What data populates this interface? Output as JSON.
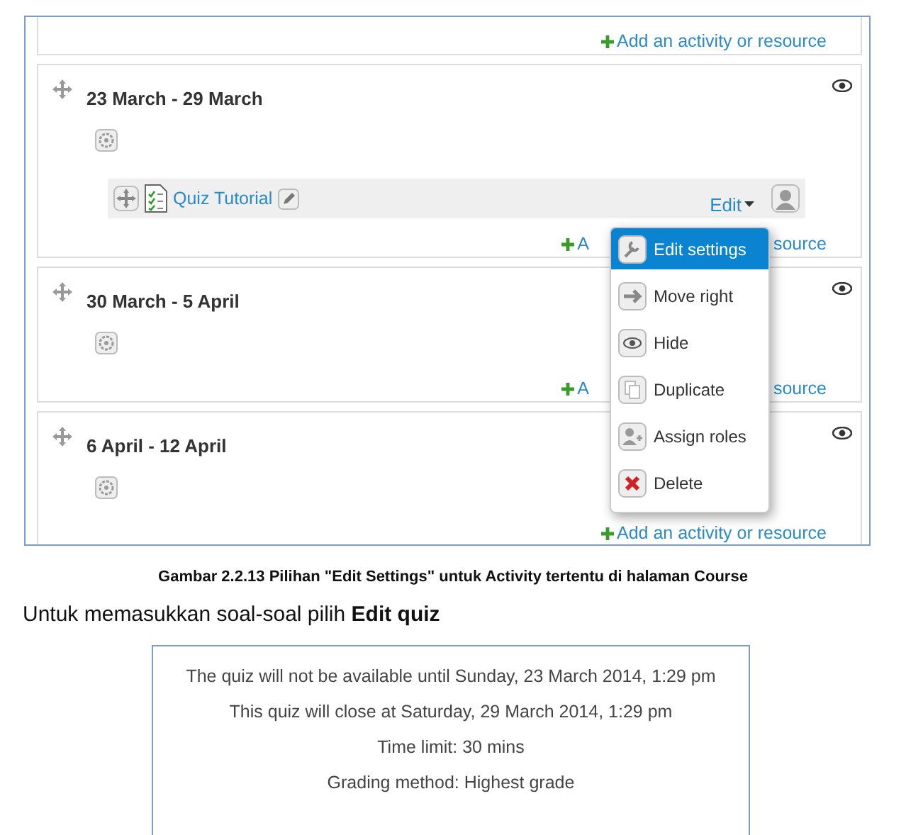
{
  "course": {
    "top_section": {
      "add_link": {
        "parts": [
          "Add an activity or resource"
        ]
      }
    },
    "sections": [
      {
        "title": "23 March - 29 March",
        "activities": [
          {
            "name": "Quiz Tutorial",
            "edit_label": "Edit"
          }
        ],
        "add_link": {
          "parts": [
            "A",
            "source"
          ]
        }
      },
      {
        "title": "30 March - 5 April",
        "add_link": {
          "parts": [
            "A",
            "source"
          ]
        }
      },
      {
        "title": "6 April - 12 April",
        "add_link": {
          "parts": [
            "Add an activity or resource"
          ]
        }
      }
    ],
    "menu": {
      "items": [
        {
          "label": "Edit settings",
          "kind": "settings",
          "selected": true
        },
        {
          "label": "Move right",
          "kind": "move",
          "selected": false
        },
        {
          "label": "Hide",
          "kind": "hide",
          "selected": false
        },
        {
          "label": "Duplicate",
          "kind": "duplicate",
          "selected": false
        },
        {
          "label": "Assign roles",
          "kind": "roles",
          "selected": false
        },
        {
          "label": "Delete",
          "kind": "delete",
          "selected": false
        }
      ]
    }
  },
  "caption": "Gambar 2.2.13 Pilihan \"Edit Settings\" untuk Activity tertentu di halaman Course",
  "paragraph": "Untuk memasukkan soal-soal pilih **Edit quiz**",
  "quiz_info": {
    "lines": [
      "The quiz will not be available until Sunday, 23 March 2014, 1:29 pm",
      "This quiz will close at Saturday, 29 March 2014, 1:29 pm",
      "Time limit: 30 mins",
      "Grading method: Highest grade"
    ]
  }
}
